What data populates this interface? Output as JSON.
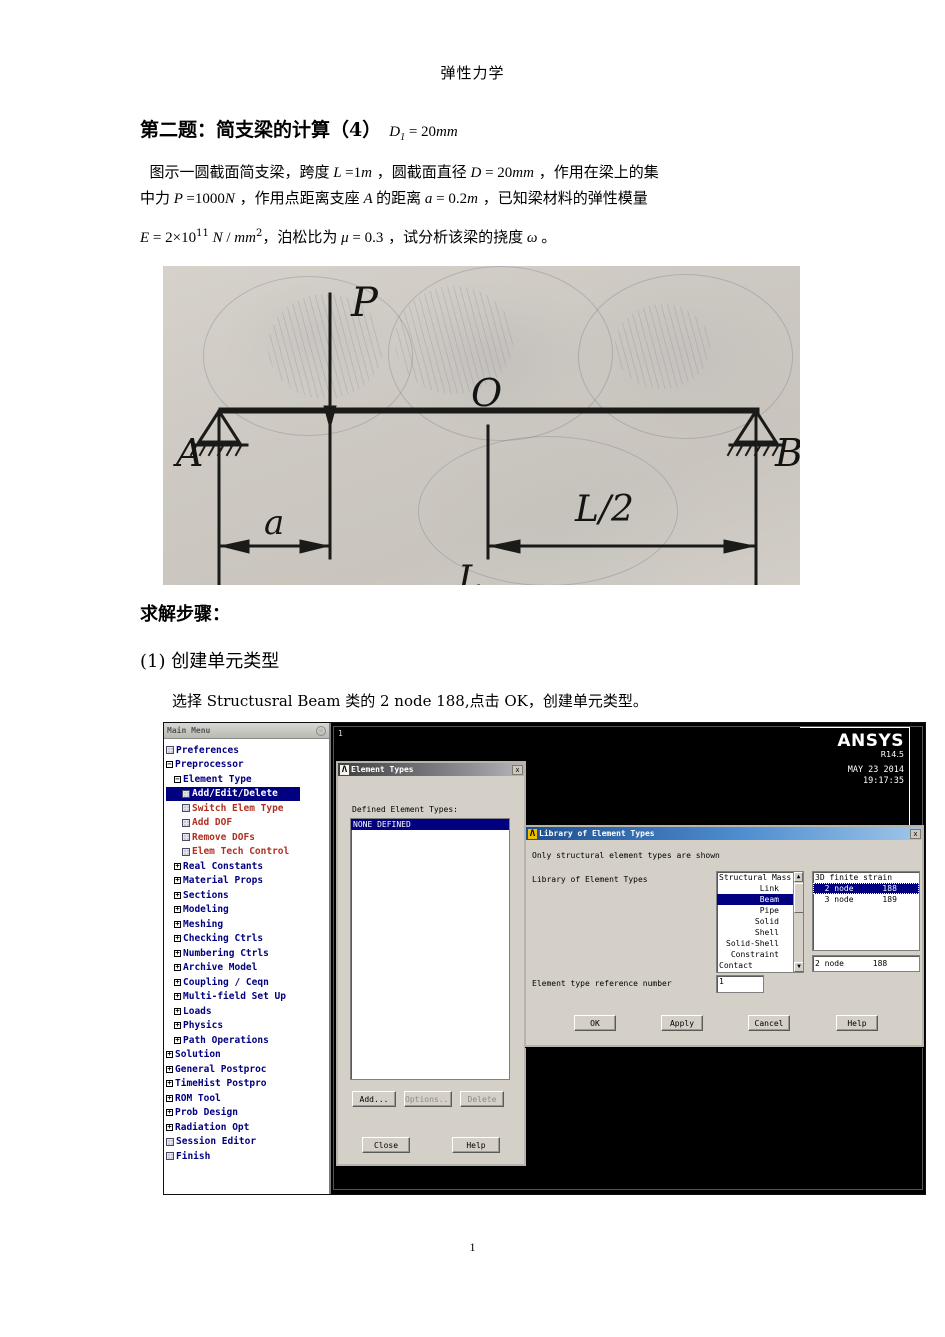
{
  "document": {
    "header": "弹性力学",
    "page_number": "1",
    "question_title": "第二题：简支梁的计算（4）",
    "question_title_formula": "D₁ = 20mm",
    "body_lines": [
      "图示一圆截面简支梁，跨度 L = 1m ，圆截面直径 D = 20mm ，作用在梁上的集",
      "中力 P = 1000N ，作用点距离支座 A 的距离 a = 0.2m ，已知梁材料的弹性模量",
      "E = 2×10¹¹ N / mm² ，泊松比为 μ = 0.3 ，试分析该梁的挠度 ω 。"
    ],
    "steps_title": "求解步骤：",
    "step_1_heading": "(1) 创建单元类型",
    "step_1_desc": "选择 Structusral Beam 类的 2 node 188,点击 OK，创建单元类型。"
  },
  "figure": {
    "caption_labels": {
      "load": "P",
      "center": "O",
      "support_left": "A",
      "support_right": "B",
      "dim_a": "a",
      "dim_half": "L/2",
      "dim_full": "L"
    }
  },
  "ansys": {
    "main_menu": {
      "title": "Main Menu",
      "pin_icon": "pin-icon",
      "items": [
        {
          "label": "Preferences",
          "indent": 0,
          "marker": "sq",
          "color": "blue",
          "selected": false
        },
        {
          "label": "Preprocessor",
          "indent": 0,
          "marker": "minus",
          "color": "blue",
          "selected": false
        },
        {
          "label": "Element Type",
          "indent": 1,
          "marker": "minus",
          "color": "blue",
          "selected": false
        },
        {
          "label": "Add/Edit/Delete",
          "indent": 2,
          "marker": "sq",
          "color": "blue",
          "selected": true
        },
        {
          "label": "Switch Elem Type",
          "indent": 2,
          "marker": "sq",
          "color": "red",
          "selected": false
        },
        {
          "label": "Add DOF",
          "indent": 2,
          "marker": "sq",
          "color": "red",
          "selected": false
        },
        {
          "label": "Remove DOFs",
          "indent": 2,
          "marker": "sq",
          "color": "red",
          "selected": false
        },
        {
          "label": "Elem Tech Control",
          "indent": 2,
          "marker": "sq",
          "color": "red",
          "selected": false
        },
        {
          "label": "Real Constants",
          "indent": 1,
          "marker": "plus",
          "color": "blue",
          "selected": false
        },
        {
          "label": "Material Props",
          "indent": 1,
          "marker": "plus",
          "color": "blue",
          "selected": false
        },
        {
          "label": "Sections",
          "indent": 1,
          "marker": "plus",
          "color": "blue",
          "selected": false
        },
        {
          "label": "Modeling",
          "indent": 1,
          "marker": "plus",
          "color": "blue",
          "selected": false
        },
        {
          "label": "Meshing",
          "indent": 1,
          "marker": "plus",
          "color": "blue",
          "selected": false
        },
        {
          "label": "Checking Ctrls",
          "indent": 1,
          "marker": "plus",
          "color": "blue",
          "selected": false
        },
        {
          "label": "Numbering Ctrls",
          "indent": 1,
          "marker": "plus",
          "color": "blue",
          "selected": false
        },
        {
          "label": "Archive Model",
          "indent": 1,
          "marker": "plus",
          "color": "blue",
          "selected": false
        },
        {
          "label": "Coupling / Ceqn",
          "indent": 1,
          "marker": "plus",
          "color": "blue",
          "selected": false
        },
        {
          "label": "Multi-field Set Up",
          "indent": 1,
          "marker": "plus",
          "color": "blue",
          "selected": false
        },
        {
          "label": "Loads",
          "indent": 1,
          "marker": "plus",
          "color": "blue",
          "selected": false
        },
        {
          "label": "Physics",
          "indent": 1,
          "marker": "plus",
          "color": "blue",
          "selected": false
        },
        {
          "label": "Path Operations",
          "indent": 1,
          "marker": "plus",
          "color": "blue",
          "selected": false
        },
        {
          "label": "Solution",
          "indent": 0,
          "marker": "plus",
          "color": "blue",
          "selected": false
        },
        {
          "label": "General Postproc",
          "indent": 0,
          "marker": "plus",
          "color": "blue",
          "selected": false
        },
        {
          "label": "TimeHist Postpro",
          "indent": 0,
          "marker": "plus",
          "color": "blue",
          "selected": false
        },
        {
          "label": "ROM Tool",
          "indent": 0,
          "marker": "plus",
          "color": "blue",
          "selected": false
        },
        {
          "label": "Prob Design",
          "indent": 0,
          "marker": "plus",
          "color": "blue",
          "selected": false
        },
        {
          "label": "Radiation Opt",
          "indent": 0,
          "marker": "plus",
          "color": "blue",
          "selected": false
        },
        {
          "label": "Session Editor",
          "indent": 0,
          "marker": "sq",
          "color": "blue",
          "selected": false
        },
        {
          "label": "Finish",
          "indent": 0,
          "marker": "sq",
          "color": "blue",
          "selected": false
        }
      ]
    },
    "graphics": {
      "window_number": "1",
      "logo": "ANSYS",
      "release": "R14.5",
      "date": "MAY 23 2014",
      "time": "19:17:35"
    },
    "element_types_dialog": {
      "title": "Element Types",
      "close_label": "x",
      "list_label": "Defined Element Types:",
      "list_items": [
        "NONE DEFINED"
      ],
      "buttons": {
        "add": "Add...",
        "options": "Options...",
        "delete": "Delete",
        "close": "Close",
        "help": "Help"
      }
    },
    "library_dialog": {
      "title": "Library of Element Types",
      "close_label": "x",
      "note": "Only structural element types are shown",
      "list_label": "Library of Element Types",
      "left_list": [
        "Structural Mass",
        "Link",
        "Beam",
        "Pipe",
        "Solid",
        "Shell",
        "Solid-Shell",
        "Constraint",
        "Contact"
      ],
      "left_selected": "Beam",
      "right_list": [
        "3D finite strain",
        "2 node      188",
        "3 node      189"
      ],
      "right_selected": "2 node      188",
      "selection_field": "2 node      188",
      "ref_num_label": "Element type reference number",
      "ref_num_value": "1",
      "buttons": {
        "ok": "OK",
        "apply": "Apply",
        "cancel": "Cancel",
        "help": "Help"
      }
    }
  },
  "colors": {
    "menu_blue": "#000080",
    "menu_red": "#b03020",
    "dialog_face": "#d4d0c8",
    "titlebar_blue": "#1d4f8f",
    "selection": "#000080"
  }
}
